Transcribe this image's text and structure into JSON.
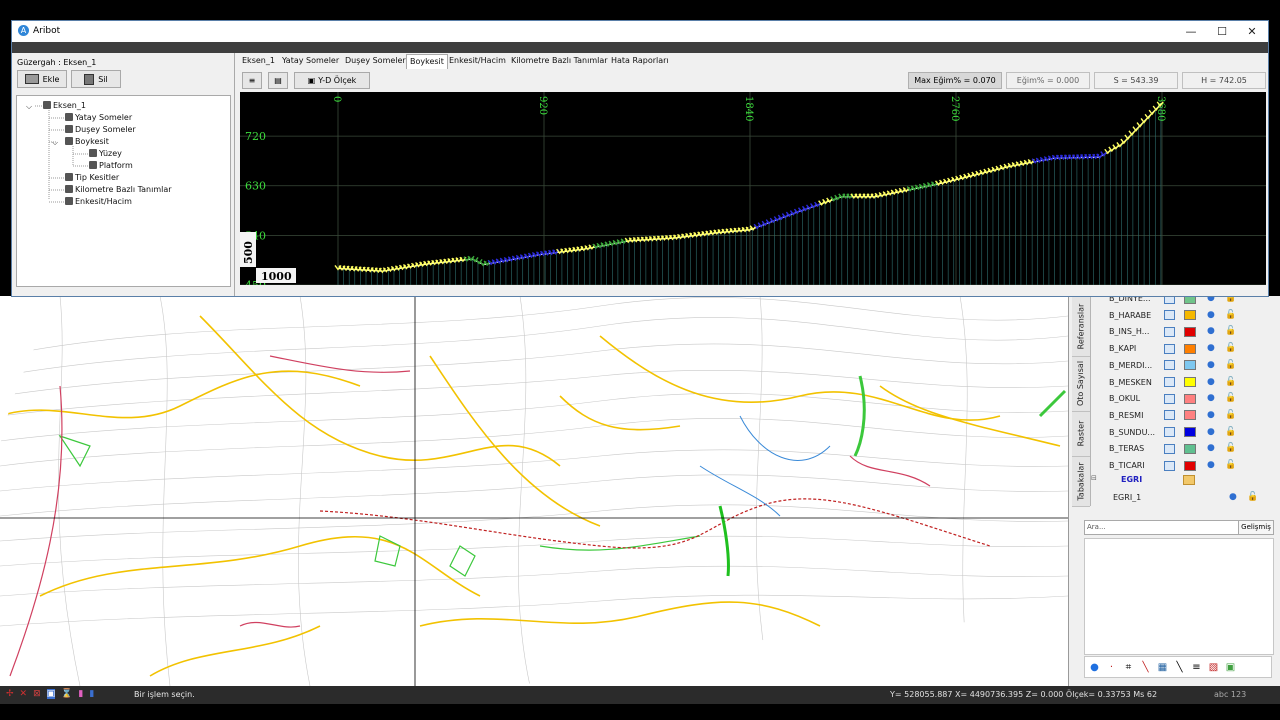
{
  "window": {
    "title": "Aribot",
    "minimize": "—",
    "maximize": "☐",
    "close": "✕"
  },
  "left_panel": {
    "route_label": "Güzergah : Eksen_1",
    "add_button": "Ekle",
    "delete_button": "Sil",
    "tree": [
      {
        "label": "Eksen_1",
        "level": 0
      },
      {
        "label": "Yatay Someler",
        "level": 1
      },
      {
        "label": "Duşey Someler",
        "level": 1
      },
      {
        "label": "Boykesit",
        "level": 1
      },
      {
        "label": "Yüzey",
        "level": 2
      },
      {
        "label": "Platform",
        "level": 2
      },
      {
        "label": "Tip Kesitler",
        "level": 1
      },
      {
        "label": "Kilometre Bazlı Tanımlar",
        "level": 1
      },
      {
        "label": "Enkesit/Hacim",
        "level": 1
      }
    ]
  },
  "tabs": [
    "Eksen_1",
    "Yatay Someler",
    "Duşey Someler",
    "Boykesit",
    "Enkesit/Hacim",
    "Kilometre Bazlı Tanımlar",
    "Hata Raporları"
  ],
  "active_tab": "Boykesit",
  "toolbar": {
    "yd_button": "Y-D Ölçek",
    "max_slope": "Max Eğim% = 0.070",
    "slope": "Eğim% = 0.000",
    "s_value": "S = 543.39",
    "h_value": "H = 742.05"
  },
  "chart_data": {
    "type": "line",
    "x_ticks": [
      "0",
      "920",
      "1840",
      "2760",
      "3680"
    ],
    "y_ticks": [
      "720",
      "630",
      "540",
      "450"
    ],
    "side_labels": {
      "vertical_scale": "500",
      "horizontal_scale": "1000"
    },
    "xlim": [
      0,
      3680
    ],
    "ylim": [
      450,
      800
    ],
    "series": [
      {
        "points": [
          [
            0,
            480
          ],
          [
            200,
            475
          ],
          [
            400,
            488
          ],
          [
            600,
            497
          ],
          [
            650,
            487
          ],
          [
            900,
            505
          ],
          [
            1100,
            515
          ],
          [
            1300,
            530
          ],
          [
            1500,
            535
          ],
          [
            1700,
            545
          ],
          [
            1840,
            550
          ],
          [
            2050,
            582
          ],
          [
            2250,
            610
          ],
          [
            2400,
            610
          ],
          [
            2700,
            635
          ],
          [
            3000,
            665
          ],
          [
            3200,
            680
          ],
          [
            3400,
            682
          ],
          [
            3500,
            705
          ],
          [
            3680,
            780
          ]
        ]
      }
    ],
    "colors": {
      "surface": "#ffffff",
      "yellow": "#ffff60",
      "green": "#3aa83a",
      "blue": "#2b2bdc",
      "grid": "#3a4a3a",
      "axis_text": "#3ddc3d"
    }
  },
  "right_panel": {
    "vertical_tabs": [
      "Referanslar",
      "Oto Sayısal",
      "Raster",
      "Tabakalar"
    ],
    "layers": [
      {
        "name": "B_DINYE...",
        "color": "#6fc48a"
      },
      {
        "name": "B_HARABE",
        "color": "#f5b800"
      },
      {
        "name": "B_INS_H...",
        "color": "#e00000"
      },
      {
        "name": "B_KAPI",
        "color": "#ff7f00"
      },
      {
        "name": "B_MERDI...",
        "color": "#7ec8f0"
      },
      {
        "name": "B_MESKEN",
        "color": "#ffff00"
      },
      {
        "name": "B_OKUL",
        "color": "#ff8080"
      },
      {
        "name": "B_RESMI",
        "color": "#ff8080"
      },
      {
        "name": "B_SUNDU...",
        "color": "#0000e0"
      },
      {
        "name": "B_TERAS",
        "color": "#60c090"
      },
      {
        "name": "B_TICARI",
        "color": "#e00000"
      }
    ],
    "group": "EGRI",
    "sub_layer": "EGRI_1",
    "search_placeholder": "Ara...",
    "advanced_button": "Gelişmiş"
  },
  "status_bar": {
    "message": "Bir işlem seçin.",
    "coords": "Y= 528055.887  X= 4490736.395  Z= 0.000   Ölçek= 0.33753  Ms 62",
    "right": "abc 123"
  }
}
